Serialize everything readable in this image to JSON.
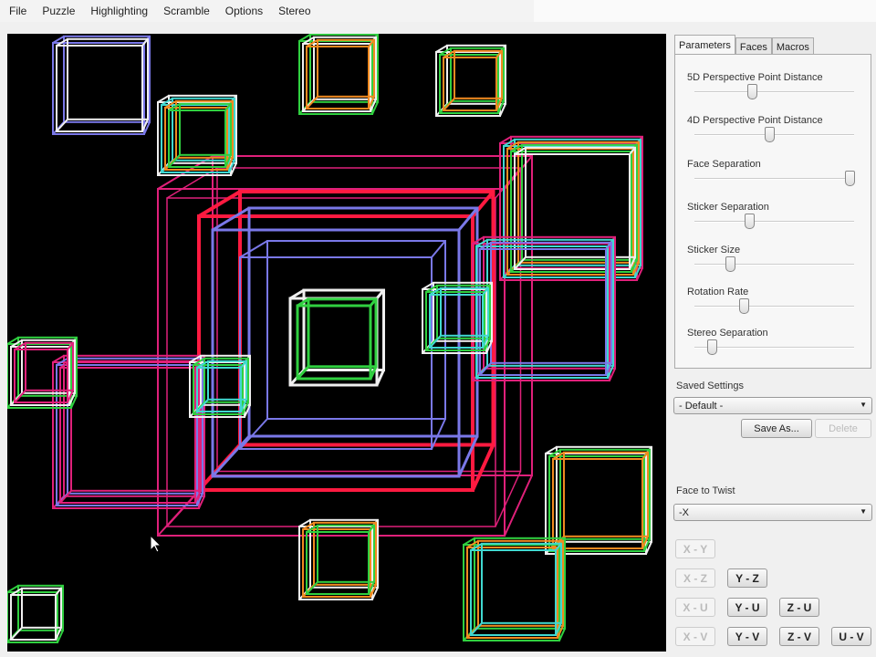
{
  "menu": [
    "File",
    "Puzzle",
    "Highlighting",
    "Scramble",
    "Options",
    "Stereo"
  ],
  "tabs": [
    "Parameters",
    "Faces",
    "Macros"
  ],
  "params": [
    {
      "label": "5D Perspective Point Distance",
      "value": 0.36
    },
    {
      "label": "4D Perspective Point Distance",
      "value": 0.47
    },
    {
      "label": "Face Separation",
      "value": 0.97
    },
    {
      "label": "Sticker Separation",
      "value": 0.34
    },
    {
      "label": "Sticker Size",
      "value": 0.22
    },
    {
      "label": "Rotation Rate",
      "value": 0.31
    },
    {
      "label": "Stereo Separation",
      "value": 0.11
    }
  ],
  "saved": {
    "label": "Saved Settings",
    "value": "- Default -",
    "save_as": "Save As...",
    "delete": "Delete"
  },
  "twist": {
    "label": "Face to Twist",
    "value": "-X"
  },
  "rotations": [
    {
      "label": "X - Y",
      "enabled": false
    },
    {
      "label": "X - Z",
      "enabled": false
    },
    {
      "label": "Y - Z",
      "enabled": true
    },
    {
      "label": "X - U",
      "enabled": false
    },
    {
      "label": "Y - U",
      "enabled": true
    },
    {
      "label": "Z - U",
      "enabled": true
    },
    {
      "label": "X - V",
      "enabled": false
    },
    {
      "label": "Y - V",
      "enabled": true
    },
    {
      "label": "Z - V",
      "enabled": true
    },
    {
      "label": "U - V",
      "enabled": true
    }
  ],
  "colors": {
    "pink": "#e0207a",
    "red": "#ff1a40",
    "blue": "#7a78e8",
    "green": "#30d040",
    "orange": "#f08a20",
    "cyan": "#40d8d0",
    "white": "#f0f0f0"
  }
}
